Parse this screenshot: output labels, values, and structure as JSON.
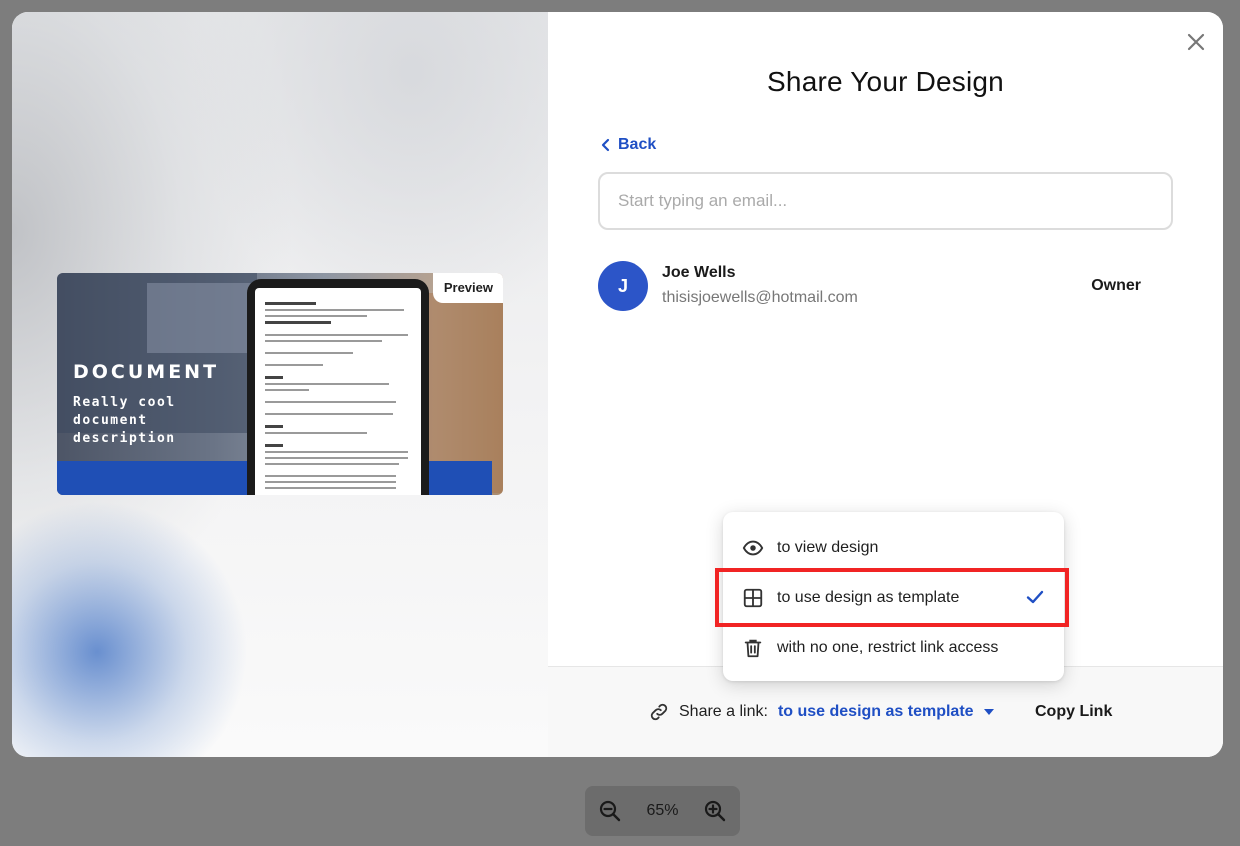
{
  "dialog": {
    "title": "Share Your Design",
    "back_label": "Back",
    "email_placeholder": "Start typing an email..."
  },
  "preview": {
    "badge": "Preview",
    "doc_title": "DOCUMENT",
    "doc_description": "Really cool document description"
  },
  "member": {
    "initial": "J",
    "name": "Joe Wells",
    "email": "thisisjoewells@hotmail.com",
    "role": "Owner"
  },
  "share": {
    "label": "Share a link:",
    "value": "to use design as template",
    "copy_label": "Copy Link"
  },
  "dropdown": {
    "options": [
      {
        "label": "to view design",
        "icon": "eye-icon",
        "selected": false
      },
      {
        "label": "to use design as template",
        "icon": "template-icon",
        "selected": true
      },
      {
        "label": "with no one, restrict link access",
        "icon": "trash-icon",
        "selected": false
      }
    ]
  },
  "zoom": {
    "value": "65%"
  },
  "colors": {
    "accent": "#1f4fc4",
    "avatar": "#2c55c8",
    "highlight": "#f12424"
  }
}
